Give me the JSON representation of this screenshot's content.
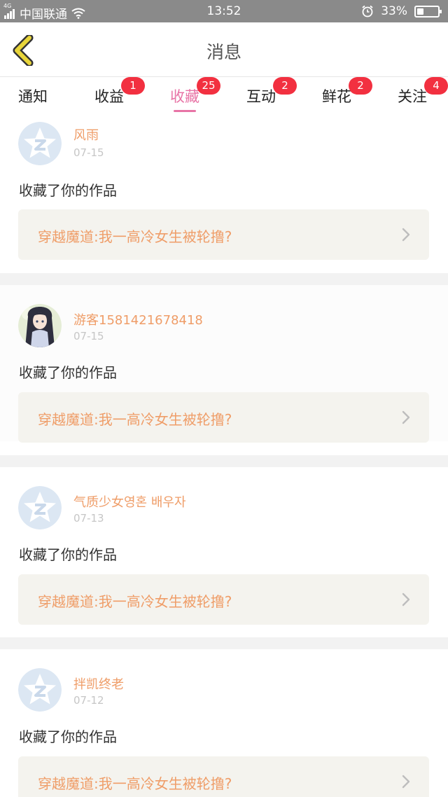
{
  "status_bar": {
    "network": "4G",
    "carrier": "中国联通",
    "time": "13:52",
    "battery": "33%",
    "battery_level": 0.33
  },
  "header": {
    "title": "消息",
    "back_icon": "chevron-left-icon",
    "accent_color": "#e8d53a"
  },
  "tabs": [
    {
      "label": "通知",
      "badge": ""
    },
    {
      "label": "收益",
      "badge": "1"
    },
    {
      "label": "收藏",
      "badge": "25",
      "active": true
    },
    {
      "label": "互动",
      "badge": "2"
    },
    {
      "label": "鲜花",
      "badge": "2"
    },
    {
      "label": "关注",
      "badge": "4"
    }
  ],
  "active_color": "#e874a6",
  "badge_color": "#f23040",
  "messages": [
    {
      "username": "风雨",
      "date": "07-15",
      "action": "收藏了你的作品",
      "work_title": "穿越魔道:我一高冷女生被轮撸?",
      "avatar": "default-star-avatar"
    },
    {
      "username": "游客1581421678418",
      "date": "07-15",
      "action": "收藏了你的作品",
      "work_title": "穿越魔道:我一高冷女生被轮撸?",
      "avatar": "anime-girl-avatar"
    },
    {
      "username": "气质少女영혼 배우자",
      "date": "07-13",
      "action": "收藏了你的作品",
      "work_title": "穿越魔道:我一高冷女生被轮撸?",
      "avatar": "default-star-avatar"
    },
    {
      "username": "拌凯终老",
      "date": "07-12",
      "action": "收藏了你的作品",
      "work_title": "穿越魔道:我一高冷女生被轮撸?",
      "avatar": "default-star-avatar"
    }
  ]
}
